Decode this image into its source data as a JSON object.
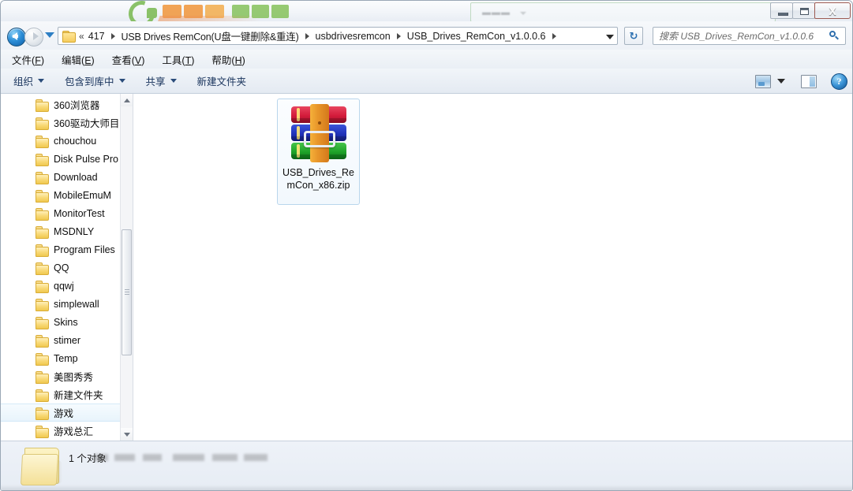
{
  "window": {
    "controls": {
      "minimize": "—",
      "maximize": "❐",
      "close": "X"
    },
    "accent_close": "#bf3c28",
    "watermark_alt": "site-logo-watermark"
  },
  "nav": {
    "back_tooltip": "后退",
    "forward_tooltip": "前进",
    "history_tooltip": "最近浏览的位置",
    "refresh_label": "↻",
    "address_chevron": "«",
    "breadcrumbs": [
      "417",
      "USB Drives RemCon(U盘一键删除&重连)",
      "usbdrivesremcon",
      "USB_Drives_RemCon_v1.0.0.6"
    ],
    "address_dropdown": "▼"
  },
  "search": {
    "placeholder": "搜索 USB_Drives_RemCon_v1.0.0.6",
    "icon": "search-icon"
  },
  "menubar": {
    "items": [
      {
        "text": "文件",
        "accel": "F"
      },
      {
        "text": "编辑",
        "accel": "E"
      },
      {
        "text": "查看",
        "accel": "V"
      },
      {
        "text": "工具",
        "accel": "T"
      },
      {
        "text": "帮助",
        "accel": "H"
      }
    ]
  },
  "toolbar": {
    "organize": "组织",
    "include_in_library": "包含到库中",
    "share": "共享",
    "new_folder": "新建文件夹",
    "views_icon": "view-layout-icon",
    "views_caret": "chevron-down-icon",
    "preview_pane_icon": "preview-pane-icon",
    "help_icon": "help-icon",
    "help_glyph": "?"
  },
  "sidebar": {
    "items": [
      {
        "label": "360浏览器",
        "hover": false
      },
      {
        "label": "360驱动大师目",
        "hover": false
      },
      {
        "label": "chouchou",
        "hover": false
      },
      {
        "label": "Disk Pulse Pro",
        "hover": false
      },
      {
        "label": "Download",
        "hover": false
      },
      {
        "label": "MobileEmuM",
        "hover": false
      },
      {
        "label": "MonitorTest",
        "hover": false
      },
      {
        "label": "MSDNLY",
        "hover": false
      },
      {
        "label": "Program Files",
        "hover": false
      },
      {
        "label": "QQ",
        "hover": false
      },
      {
        "label": "qqwj",
        "hover": false
      },
      {
        "label": "simplewall",
        "hover": false
      },
      {
        "label": "Skins",
        "hover": false
      },
      {
        "label": "stimer",
        "hover": false
      },
      {
        "label": "Temp",
        "hover": false
      },
      {
        "label": "美图秀秀",
        "hover": false
      },
      {
        "label": "新建文件夹",
        "hover": false
      },
      {
        "label": "游戏",
        "hover": true
      },
      {
        "label": "游戏总汇",
        "hover": false
      }
    ],
    "scrollbar": {
      "up_arrow": "▲",
      "down_arrow": "▼"
    }
  },
  "files": [
    {
      "name": "USB_Drives_RemCon_x86.zip",
      "icon": "winrar-archive-icon",
      "selected": true
    }
  ],
  "status": {
    "count_text": "1 个对象",
    "folder_icon": "folder-icon"
  }
}
